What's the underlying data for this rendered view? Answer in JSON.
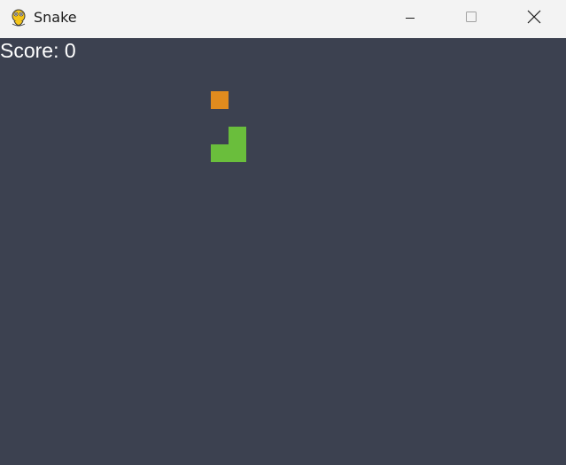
{
  "window": {
    "title": "Snake",
    "app_icon": "python-snake-icon"
  },
  "game": {
    "score_text": "Score: 0",
    "background_color": "#3c4150",
    "food_color": "#e08b1e",
    "snake_color": "#6abe3c"
  }
}
